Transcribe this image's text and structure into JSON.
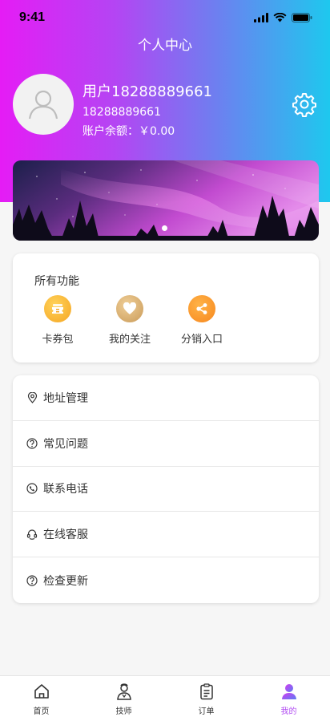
{
  "status_bar": {
    "time": "9:41"
  },
  "header": {
    "title": "个人中心"
  },
  "profile": {
    "username": "用户18288889661",
    "phone": "18288889661",
    "balance": "账户余额：￥0.00"
  },
  "functions": {
    "title": "所有功能",
    "items": [
      {
        "label": "卡券包",
        "icon": "ticket-icon",
        "color": "#f5a623"
      },
      {
        "label": "我的关注",
        "icon": "heart-icon",
        "color": "#d5ab6a"
      },
      {
        "label": "分销入口",
        "icon": "share-icon",
        "color": "#f7931e"
      }
    ]
  },
  "menu": [
    {
      "label": "地址管理",
      "icon": "location-pin-icon"
    },
    {
      "label": "常见问题",
      "icon": "question-icon"
    },
    {
      "label": "联系电话",
      "icon": "phone-icon"
    },
    {
      "label": "在线客服",
      "icon": "headset-icon"
    },
    {
      "label": "检查更新",
      "icon": "question-icon"
    }
  ],
  "tabbar": [
    {
      "label": "首页",
      "icon": "home-icon"
    },
    {
      "label": "技师",
      "icon": "technician-icon"
    },
    {
      "label": "订单",
      "icon": "order-icon"
    },
    {
      "label": "我的",
      "icon": "user-icon",
      "active": true
    }
  ],
  "colors": {
    "accent": "#b14cf2",
    "gradient_start": "#e51cf5",
    "gradient_end": "#1ec8ee"
  }
}
